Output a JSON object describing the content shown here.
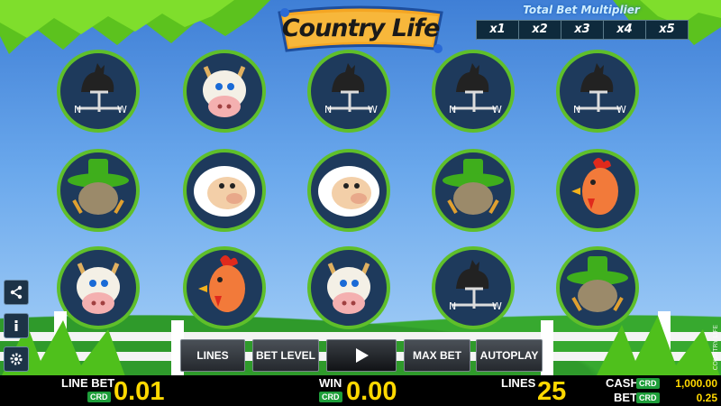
{
  "game": {
    "logo_text": "Country Life",
    "vertical_brand": "COUNTRY LIFE"
  },
  "multiplier": {
    "title": "Total Bet Multiplier",
    "options": [
      "x1",
      "x2",
      "x3",
      "x4",
      "x5"
    ]
  },
  "reels": [
    [
      "rooster-weathervane",
      "scarecrow",
      "cow"
    ],
    [
      "cow",
      "sheep",
      "chicken"
    ],
    [
      "rooster-weathervane",
      "sheep",
      "cow"
    ],
    [
      "rooster-weathervane",
      "scarecrow",
      "rooster-weathervane"
    ],
    [
      "rooster-weathervane",
      "chicken",
      "scarecrow"
    ]
  ],
  "controls": {
    "lines_label": "LINES",
    "bet_level_label": "BET LEVEL",
    "max_bet_label": "MAX BET",
    "autoplay_label": "AUTOPLAY"
  },
  "side_icons": [
    "share-icon",
    "info-icon",
    "gear-icon"
  ],
  "status": {
    "line_bet_label": "LINE BET",
    "line_bet_value": "0.01",
    "win_label": "WIN",
    "win_value": "0.00",
    "lines_label": "LINES",
    "lines_value": "25",
    "cash_label": "CASH",
    "cash_value": "1,000.00",
    "bet_label": "BET",
    "bet_value": "0.25",
    "currency_badge": "CRD"
  },
  "colors": {
    "value_yellow": "#ffd800",
    "badge_green": "#1e9e3a",
    "symbol_circle": "#1e3a5c"
  }
}
